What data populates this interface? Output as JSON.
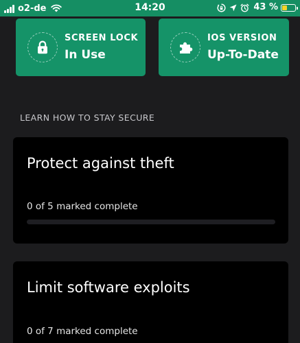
{
  "status_bar": {
    "carrier": "o2-de",
    "time": "14:20",
    "battery_percent": "43 %",
    "battery_level": 0.43,
    "icons": [
      "signal-icon",
      "wifi-icon",
      "screen-rotation-lock-icon",
      "location-arrow-icon",
      "alarm-icon",
      "battery-icon"
    ],
    "colors": {
      "bar": "#158e63",
      "battery_fill": "#f5d32a"
    }
  },
  "tiles": [
    {
      "label": "SCREEN LOCK",
      "value": "In Use",
      "icon": "padlock-icon"
    },
    {
      "label": "IOS VERSION",
      "value": "Up-To-Date",
      "icon": "puzzle-piece-icon"
    }
  ],
  "section": {
    "title": "LEARN HOW TO STAY SECURE"
  },
  "cards": [
    {
      "title": "Protect against theft",
      "progress_text": "0 of 5 marked complete",
      "progress": 0
    },
    {
      "title": "Limit software exploits",
      "progress_text": "0 of 7 marked complete",
      "progress": 0
    }
  ],
  "colors": {
    "accent": "#159368",
    "background": "#1c1c1e",
    "card": "#000000"
  }
}
